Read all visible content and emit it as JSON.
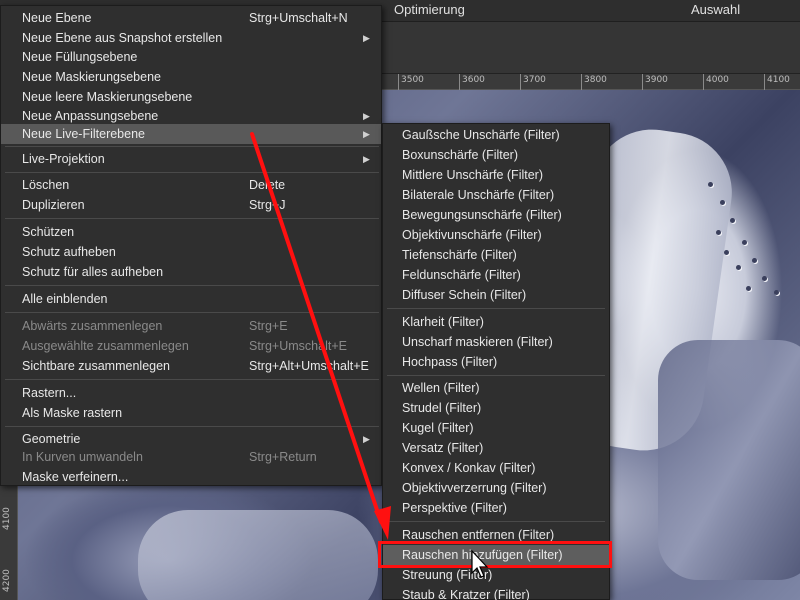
{
  "topbar": {
    "tab_optimierung": "Optimierung",
    "tab_auswahl": "Auswahl"
  },
  "ruler": {
    "h_ticks": [
      "3500",
      "3600",
      "3700",
      "3800",
      "3900",
      "4000",
      "4100"
    ],
    "v_ticks": [
      "4100",
      "4200"
    ]
  },
  "menu": {
    "items": [
      {
        "label": "Neue Ebene",
        "shortcut": "Strg+Umschalt+N"
      },
      {
        "label": "Neue Ebene aus Snapshot erstellen",
        "shortcut": "",
        "submenu": true
      },
      {
        "label": "Neue Füllungsebene",
        "shortcut": ""
      },
      {
        "label": "Neue Maskierungsebene",
        "shortcut": ""
      },
      {
        "label": "Neue leere Maskierungsebene",
        "shortcut": ""
      },
      {
        "label": "Neue Anpassungsebene",
        "shortcut": "",
        "submenu": true
      },
      {
        "label": "Neue Live-Filterebene",
        "shortcut": "",
        "submenu": true,
        "highlighted": true
      },
      {
        "label": "Live-Projektion",
        "shortcut": "",
        "submenu": true
      },
      {
        "label": "Löschen",
        "shortcut": "Delete"
      },
      {
        "label": "Duplizieren",
        "shortcut": "Strg+J"
      },
      {
        "label": "Schützen",
        "shortcut": ""
      },
      {
        "label": "Schutz aufheben",
        "shortcut": ""
      },
      {
        "label": "Schutz für alles aufheben",
        "shortcut": ""
      },
      {
        "label": "Alle einblenden",
        "shortcut": ""
      },
      {
        "label": "Abwärts zusammenlegen",
        "shortcut": "Strg+E",
        "disabled": true
      },
      {
        "label": "Ausgewählte zusammenlegen",
        "shortcut": "Strg+Umschalt+E",
        "disabled": true
      },
      {
        "label": "Sichtbare zusammenlegen",
        "shortcut": "Strg+Alt+Umschalt+E"
      },
      {
        "label": "Rastern...",
        "shortcut": ""
      },
      {
        "label": "Als Maske rastern",
        "shortcut": ""
      },
      {
        "label": "Geometrie",
        "shortcut": "",
        "submenu": true
      },
      {
        "label": "In Kurven umwandeln",
        "shortcut": "Strg+Return",
        "disabled": true
      },
      {
        "label": "Maske verfeinern...",
        "shortcut": ""
      }
    ]
  },
  "submenu": {
    "items": [
      {
        "label": "Gaußsche Unschärfe (Filter)"
      },
      {
        "label": "Boxunschärfe (Filter)"
      },
      {
        "label": "Mittlere Unschärfe (Filter)"
      },
      {
        "label": "Bilaterale Unschärfe (Filter)"
      },
      {
        "label": "Bewegungsunschärfe (Filter)"
      },
      {
        "label": "Objektivunschärfe (Filter)"
      },
      {
        "label": "Tiefenschärfe (Filter)"
      },
      {
        "label": "Feldunschärfe (Filter)"
      },
      {
        "label": "Diffuser Schein (Filter)"
      },
      {
        "label": "Klarheit (Filter)"
      },
      {
        "label": "Unscharf maskieren (Filter)"
      },
      {
        "label": "Hochpass (Filter)"
      },
      {
        "label": "Wellen (Filter)"
      },
      {
        "label": "Strudel (Filter)"
      },
      {
        "label": "Kugel (Filter)"
      },
      {
        "label": "Versatz (Filter)"
      },
      {
        "label": "Konvex / Konkav (Filter)"
      },
      {
        "label": "Objektivverzerrung (Filter)"
      },
      {
        "label": "Perspektive (Filter)"
      },
      {
        "label": "Rauschen entfernen (Filter)"
      },
      {
        "label": "Rauschen hinzufügen (Filter)",
        "highlighted": true
      },
      {
        "label": "Streuung (Filter)"
      },
      {
        "label": "Staub & Kratzer (Filter)"
      }
    ]
  },
  "colors": {
    "annotation_red": "#ff1010",
    "menu_bg": "#2f2f2f",
    "highlight_bg": "#595959"
  },
  "icons": {
    "submenu_arrow": "chevron-right-icon",
    "cursor": "mouse-pointer-icon",
    "annotation": "red-arrow-annotation"
  }
}
